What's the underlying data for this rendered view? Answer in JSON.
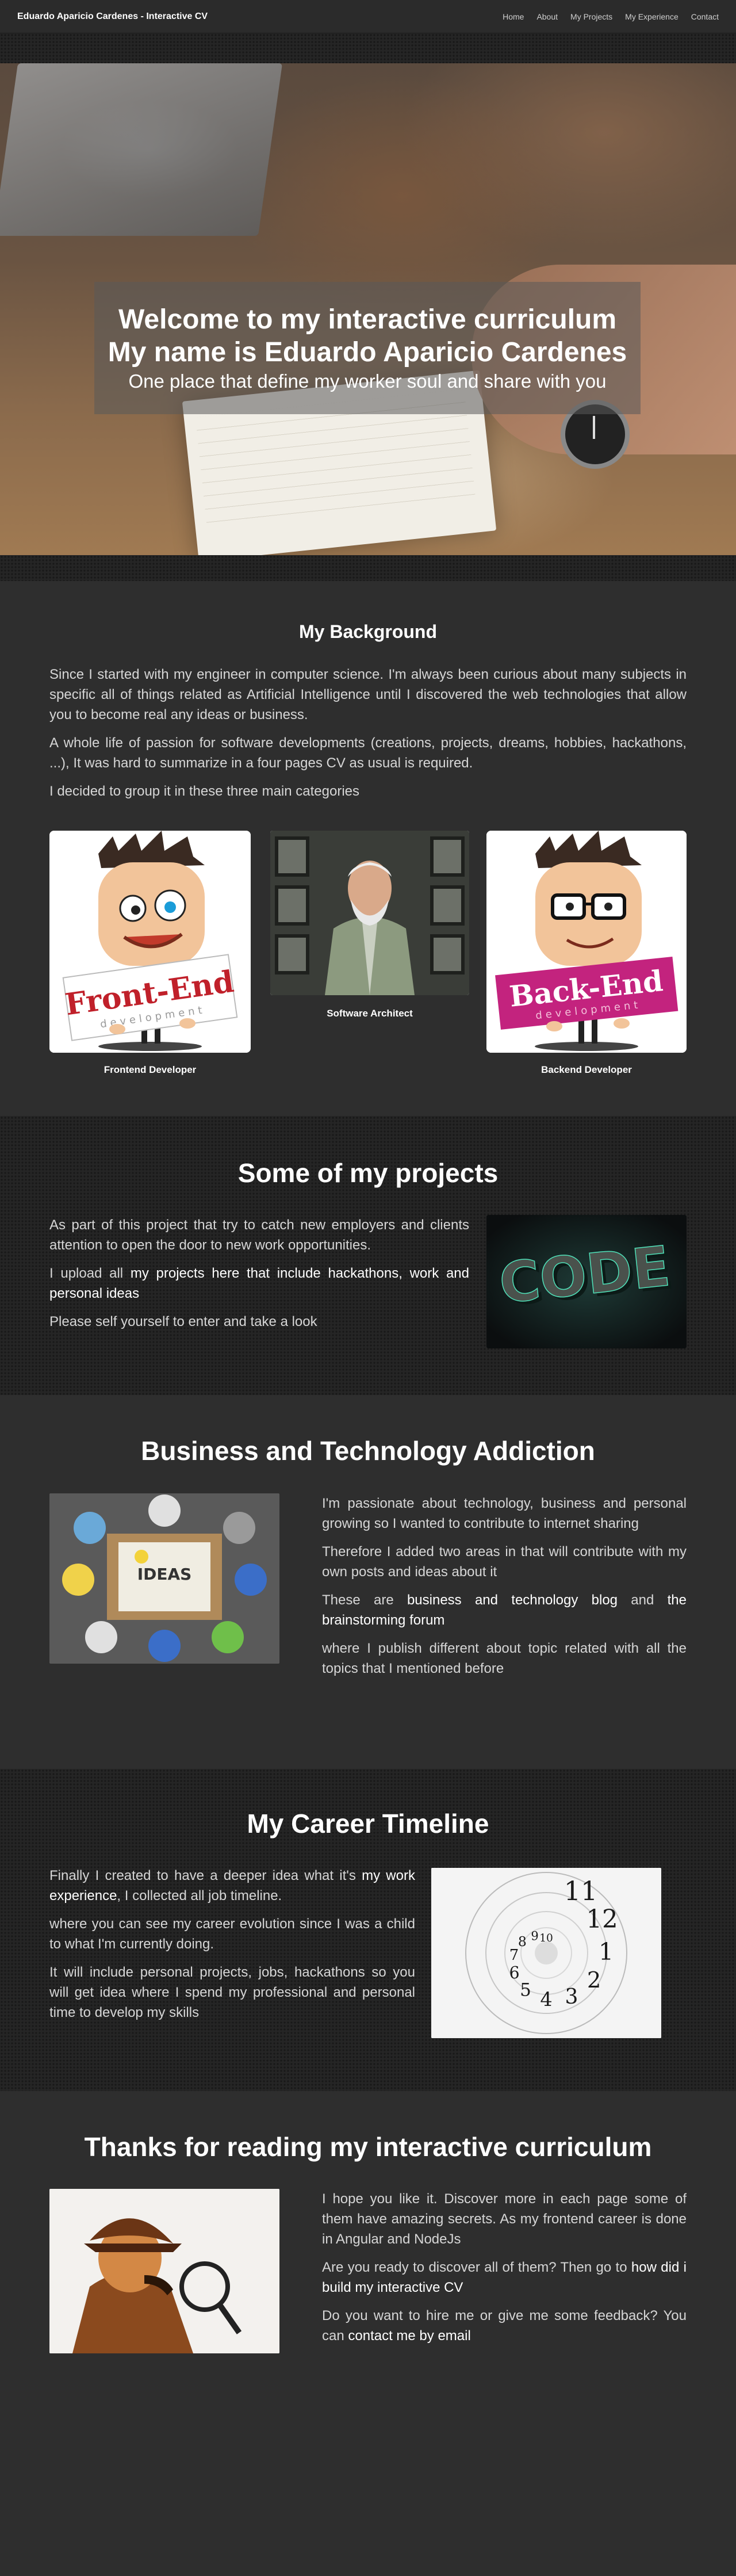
{
  "nav": {
    "brand": "Eduardo Aparicio Cardenes - Interactive CV",
    "links": [
      "Home",
      "About",
      "My Projects",
      "My Experience",
      "Contact"
    ]
  },
  "hero": {
    "line1": "Welcome to my interactive curriculum",
    "line2": "My name is Eduardo Aparicio Cardenes",
    "line3": "One place that define my worker soul and share with you"
  },
  "background": {
    "title": "My Background",
    "p1": "Since I started with my engineer in computer science. I'm always been curious about many subjects in specific all of things related as Artificial Intelligence until I discovered the web technologies that allow you to become real any ideas or business.",
    "p2": "A whole life of passion for software developments (creations, projects, dreams, hobbies, hackathons, ...), It was hard to summarize in a four pages CV as usual is required.",
    "p3": "I decided to group it in these three main categories",
    "cards": [
      {
        "caption": "Frontend Developer",
        "sign": "Front-End",
        "sub": "development"
      },
      {
        "caption": "Software Architect"
      },
      {
        "caption": "Backend Developer",
        "sign": "Back-End",
        "sub": "development"
      }
    ]
  },
  "projects": {
    "title": "Some of my projects",
    "p1": "As part of this project that try to catch new employers and clients attention to open the door to new work opportunities.",
    "p2_pre": "I upload all ",
    "p2_link": "my projects here that include hackathons, work and personal ideas",
    "p3": "Please self yourself to enter and take a look",
    "image_text": "CODE"
  },
  "business": {
    "title": "Business and Technology Addiction",
    "p1": "I'm passionate about technology, business and personal growing so I wanted to contribute to internet sharing",
    "p2": "Therefore I added two areas in that will contribute with my own posts and ideas about it",
    "p3_pre": "These are ",
    "p3_link1": "business and technology blog",
    "p3_mid": " and ",
    "p3_link2": "the brainstorming forum",
    "p4": "where I publish different about topic related with all the topics that I mentioned before",
    "image_text": "IDEAS"
  },
  "career": {
    "title": "My Career Timeline",
    "p1_pre": "Finally I created to have a deeper idea what it's ",
    "p1_link": "my work experience",
    "p1_post": ", I collected all job timeline.",
    "p2": "where you can see my career evolution since I was a child to what I'm currently doing.",
    "p3": "It will include personal projects, jobs, hackathons so you will get idea where I spend my professional and personal time to develop my skills",
    "clock_numbers": [
      "11",
      "12",
      "1",
      "2",
      "3",
      "4",
      "5",
      "6",
      "7",
      "8",
      "9",
      "10"
    ]
  },
  "thanks": {
    "title": "Thanks for reading my interactive curriculum",
    "p1": "I hope you like it. Discover more in each page some of them have amazing secrets. As my frontend career is done in Angular and NodeJs",
    "p2_pre": "Are you ready to discover all of them? Then go to ",
    "p2_link": "how did i build my interactive CV",
    "p3_pre": "Do you want to hire me or give me some feedback? You can ",
    "p3_link": "contact me by email"
  }
}
